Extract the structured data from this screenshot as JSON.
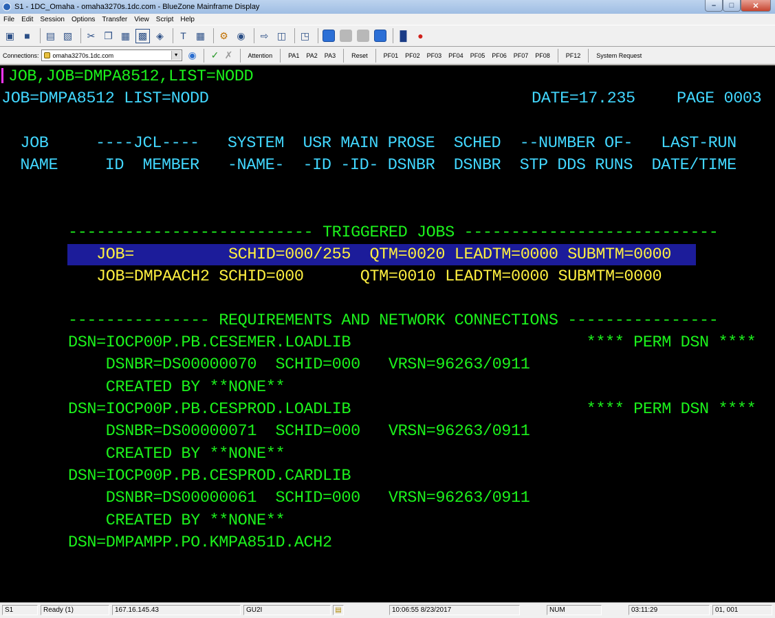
{
  "window": {
    "title": "S1 - 1DC_Omaha - omaha3270s.1dc.com - BlueZone Mainframe Display",
    "min": "–",
    "max": "□",
    "close": "✕"
  },
  "menu": [
    "File",
    "Edit",
    "Session",
    "Options",
    "Transfer",
    "View",
    "Script",
    "Help"
  ],
  "toolbar2": {
    "connections_label": "Connections:",
    "connection_value": "omaha3270s.1dc.com",
    "buttons": [
      "Attention",
      "PA1",
      "PA2",
      "PA3",
      "Reset",
      "PF01",
      "PF02",
      "PF03",
      "PF04",
      "PF05",
      "PF06",
      "PF07",
      "PF08",
      "PF12",
      "System Request"
    ]
  },
  "colors": {
    "green": "#1cf21c",
    "turquoise": "#42d7ff",
    "yellow": "#fff040",
    "highlight": "#1c1c9a",
    "cursor": "#ff35ff"
  },
  "terminal": {
    "line1": "JOB,JOB=DMPA8512,LIST=NODD",
    "line2_left": "JOB=DMPA8512 LIST=NODD",
    "line2_date": "DATE=17.235",
    "line2_page": "PAGE 0003",
    "header1": "  JOB     ----JCL----   SYSTEM  USR MAIN PROSE  SCHED  --NUMBER OF-   LAST-RUN",
    "header2": "  NAME     ID  MEMBER   -NAME-  -ID -ID- DSNBR  DSNBR  STP DDS RUNS  DATE/TIME",
    "triggered_title": "-------------------------- TRIGGERED JOBS ---------------------------",
    "triggered_rows": [
      "   JOB=          SCHID=000/255  QTM=0020 LEADTM=0000 SUBMTM=0000",
      "   JOB=DMPAACH2 SCHID=000      QTM=0010 LEADTM=0000 SUBMTM=0000"
    ],
    "req_title": "--------------- REQUIREMENTS AND NETWORK CONNECTIONS ----------------",
    "req_lines": [
      "DSN=IOCP00P.PB.CESEMER.LOADLIB                         **** PERM DSN ****",
      "    DSNBR=DS00000070  SCHID=000   VRSN=96263/0911",
      "    CREATED BY **NONE**",
      "DSN=IOCP00P.PB.CESPROD.LOADLIB                         **** PERM DSN ****",
      "    DSNBR=DS00000071  SCHID=000   VRSN=96263/0911",
      "    CREATED BY **NONE**",
      "DSN=IOCP00P.PB.CESPROD.CARDLIB",
      "    DSNBR=DS00000061  SCHID=000   VRSN=96263/0911",
      "    CREATED BY **NONE**",
      "DSN=DMPAMPP.PO.KMPA851D.ACH2"
    ]
  },
  "status": {
    "session": "S1",
    "state": "Ready (1)",
    "ip": "167.16.145.43",
    "lu": "GU2I",
    "datetime": "10:06:55  8/23/2017",
    "num": "NUM",
    "elapsed": "03:11:29",
    "cursor_pos": "01, 001"
  }
}
